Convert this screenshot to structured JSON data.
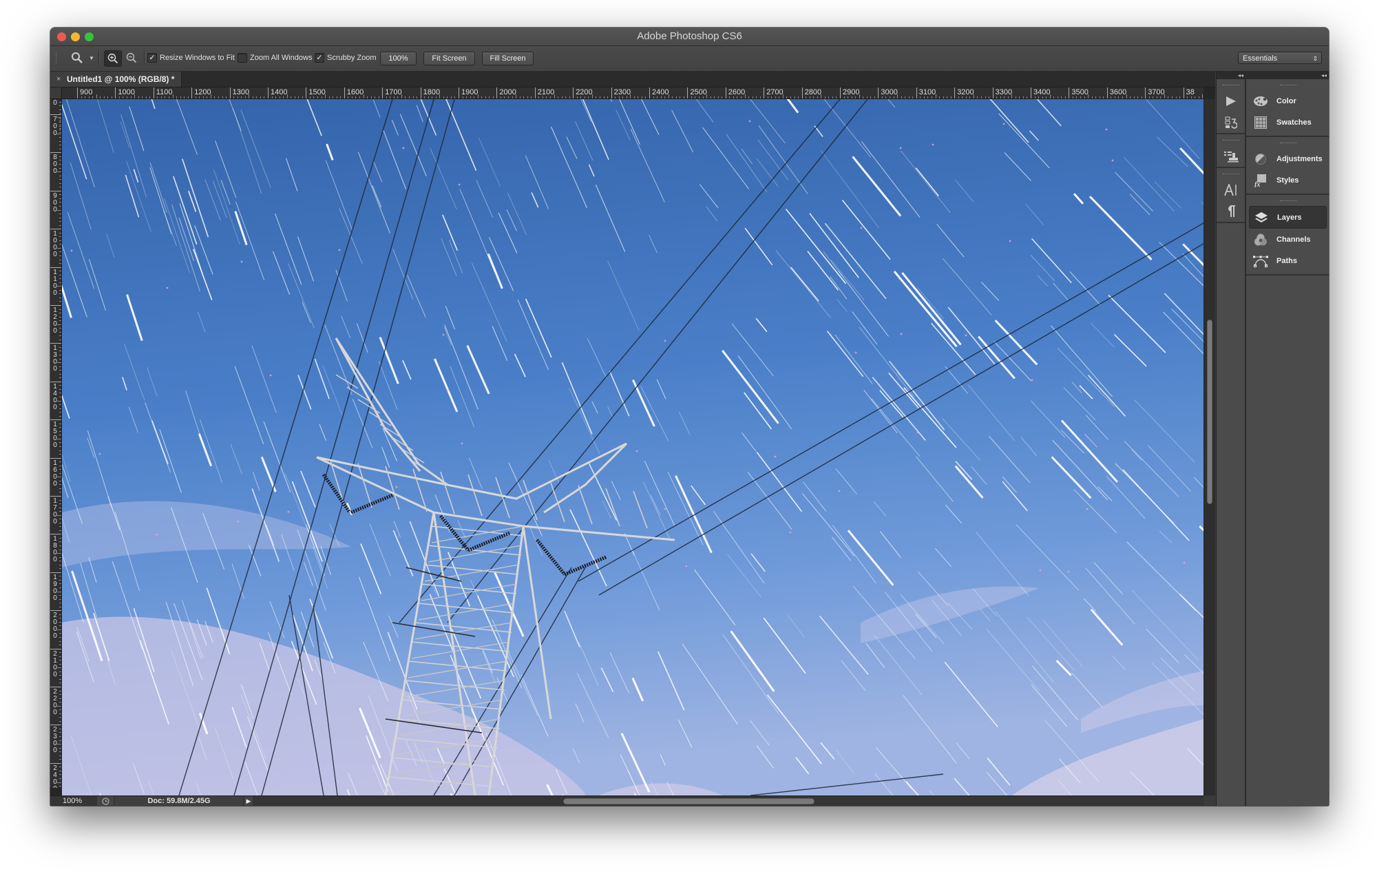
{
  "app": {
    "title": "Adobe Photoshop CS6"
  },
  "options_bar": {
    "tool": "zoom-tool",
    "zoom_in_active": true,
    "checkboxes": [
      {
        "label": "Resize Windows to Fit",
        "checked": true
      },
      {
        "label": "Zoom All Windows",
        "checked": false
      },
      {
        "label": "Scrubby Zoom",
        "checked": true
      }
    ],
    "buttons": {
      "actual": "100%",
      "fit": "Fit Screen",
      "fill": "Fill Screen"
    },
    "workspace": "Essentials"
  },
  "document": {
    "tab_label": "Untitled1 @ 100% (RGB/8) *",
    "close_glyph": "×",
    "ruler_h": [
      "900",
      "1000",
      "1100",
      "1200",
      "1300",
      "1400",
      "1500",
      "1600",
      "1700",
      "1800",
      "1900",
      "2000",
      "2100",
      "2200",
      "2300",
      "2400",
      "2500",
      "2600",
      "2700",
      "2800",
      "2900",
      "3000",
      "3100",
      "3200",
      "3300",
      "3400",
      "3500",
      "3600",
      "3700",
      "38"
    ],
    "ruler_v": [
      "0",
      "700",
      "800",
      "900",
      "1000",
      "1100",
      "1200",
      "1300",
      "1400",
      "1500",
      "1600",
      "1700",
      "1800",
      "1900",
      "2000",
      "2100",
      "2200",
      "2300",
      "2400"
    ],
    "image_description": "Star trails over electricity pylon with power lines against blue sky",
    "colors": {
      "sky_top": "#3566ad",
      "sky_mid": "#5d8fd4",
      "sky_bottom": "#a6b6e0",
      "cloud": "#cdc8e6"
    },
    "scroll": {
      "vertical_thumb": "upper-middle",
      "horizontal_thumb": "center"
    }
  },
  "status_bar": {
    "zoom": "100%",
    "doc_info": "Doc: 59.8M/2.45G",
    "arrow": "▶"
  },
  "dock": {
    "collapse_glyph": "◂◂",
    "icon_groups": [
      [
        "play-icon",
        "history-icon"
      ],
      [
        "clone-source-icon"
      ],
      [
        "character-icon",
        "paragraph-icon"
      ]
    ],
    "panel_groups": [
      [
        {
          "label": "Color",
          "icon": "palette-icon"
        },
        {
          "label": "Swatches",
          "icon": "swatches-grid-icon"
        }
      ],
      [
        {
          "label": "Adjustments",
          "icon": "adjustments-icon"
        },
        {
          "label": "Styles",
          "icon": "styles-fx-icon"
        }
      ],
      [
        {
          "label": "Layers",
          "icon": "layers-icon",
          "active": true
        },
        {
          "label": "Channels",
          "icon": "channels-icon"
        },
        {
          "label": "Paths",
          "icon": "paths-icon"
        }
      ]
    ]
  }
}
